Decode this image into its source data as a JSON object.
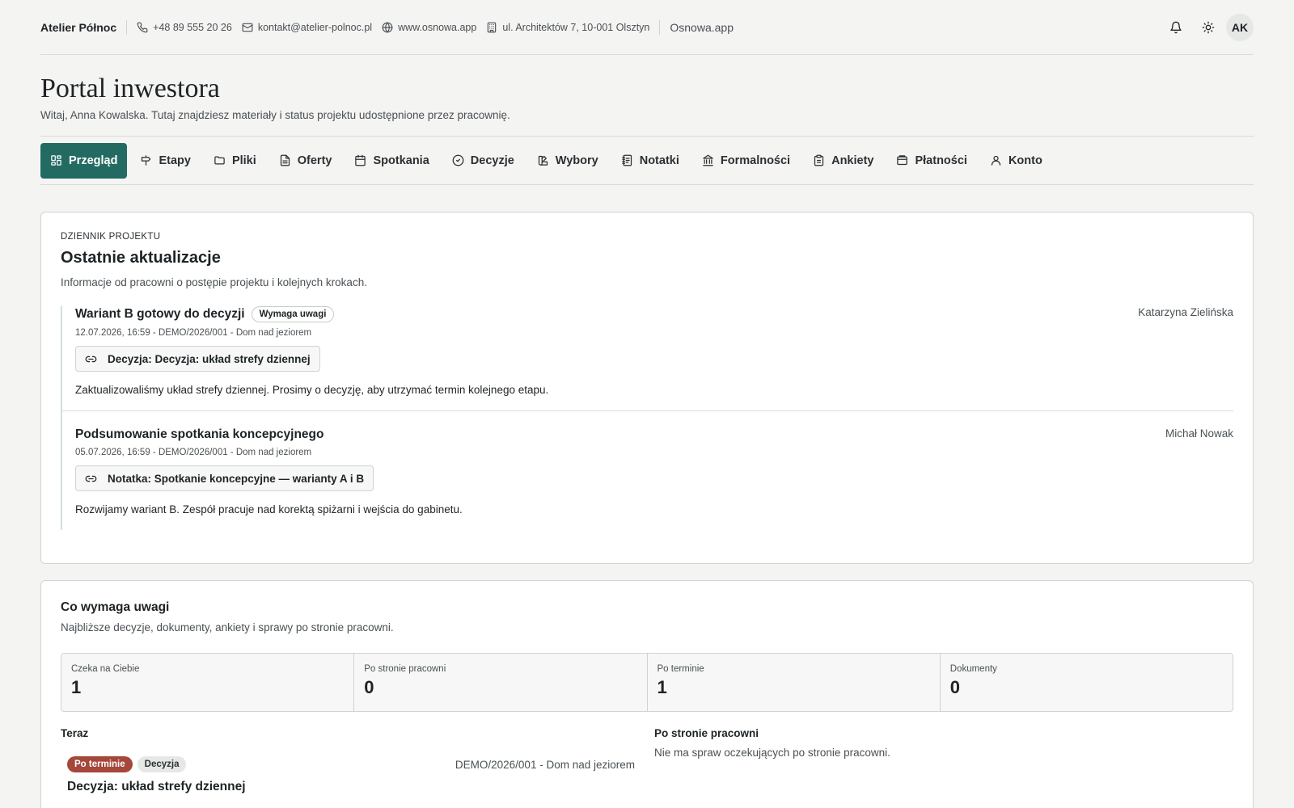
{
  "topbar": {
    "brand": "Atelier Północ",
    "phone": "+48 89 555 20 26",
    "email": "kontakt@atelier-polnoc.pl",
    "website": "www.osnowa.app",
    "address": "ul. Architektów 7, 10-001 Olsztyn",
    "app_name": "Osnowa.app",
    "avatar_initials": "AK"
  },
  "header": {
    "title": "Portal inwestora",
    "subtitle": "Witaj, Anna Kowalska. Tutaj znajdziesz materiały i status projektu udostępnione przez pracownię."
  },
  "nav": {
    "active_color": "#236b62",
    "items": [
      {
        "label": "Przegląd",
        "icon": "grid-icon"
      },
      {
        "label": "Etapy",
        "icon": "signpost-icon"
      },
      {
        "label": "Pliki",
        "icon": "folder-icon"
      },
      {
        "label": "Oferty",
        "icon": "document-icon"
      },
      {
        "label": "Spotkania",
        "icon": "calendar-icon"
      },
      {
        "label": "Decyzje",
        "icon": "check-circle-icon"
      },
      {
        "label": "Wybory",
        "icon": "swatch-icon"
      },
      {
        "label": "Notatki",
        "icon": "notebook-icon"
      },
      {
        "label": "Formalności",
        "icon": "institution-icon"
      },
      {
        "label": "Ankiety",
        "icon": "clipboard-icon"
      },
      {
        "label": "Płatności",
        "icon": "wallet-icon"
      },
      {
        "label": "Konto",
        "icon": "user-icon"
      }
    ]
  },
  "journal": {
    "eyebrow": "Dziennik projektu",
    "title": "Ostatnie aktualizacje",
    "description": "Informacje od pracowni o postępie projektu i kolejnych krokach.",
    "entries": [
      {
        "title": "Wariant B gotowy do decyzji",
        "badge": "Wymaga uwagi",
        "author": "Katarzyna Zielińska",
        "meta": "12.07.2026, 16:59 - DEMO/2026/001 - Dom nad jeziorem",
        "link": "Decyzja: Decyzja: układ strefy dziennej",
        "body": "Zaktualizowaliśmy układ strefy dziennej. Prosimy o decyzję, aby utrzymać termin kolejnego etapu."
      },
      {
        "title": "Podsumowanie spotkania koncepcyjnego",
        "author": "Michał Nowak",
        "meta": "05.07.2026, 16:59 - DEMO/2026/001 - Dom nad jeziorem",
        "link": "Notatka: Spotkanie koncepcyjne — warianty A i B",
        "body": "Rozwijamy wariant B. Zespół pracuje nad korektą spiżarni i wejścia do gabinetu."
      }
    ]
  },
  "attention": {
    "title": "Co wymaga uwagi",
    "description": "Najbliższe decyzje, dokumenty, ankiety i sprawy po stronie pracowni.",
    "stats": [
      {
        "label": "Czeka na Ciebie",
        "value": "1"
      },
      {
        "label": "Po stronie pracowni",
        "value": "0"
      },
      {
        "label": "Po terminie",
        "value": "1"
      },
      {
        "label": "Dokumenty",
        "value": "0"
      }
    ],
    "now": {
      "title": "Teraz",
      "overdue_pill": "Po terminie",
      "overdue_color": "#a5473a",
      "type_pill": "Decyzja",
      "project": "DEMO/2026/001 - Dom nad jeziorem",
      "task_title": "Decyzja: układ strefy dziennej"
    },
    "studio_side": {
      "title": "Po stronie pracowni",
      "empty": "Nie ma spraw oczekujących po stronie pracowni."
    }
  }
}
